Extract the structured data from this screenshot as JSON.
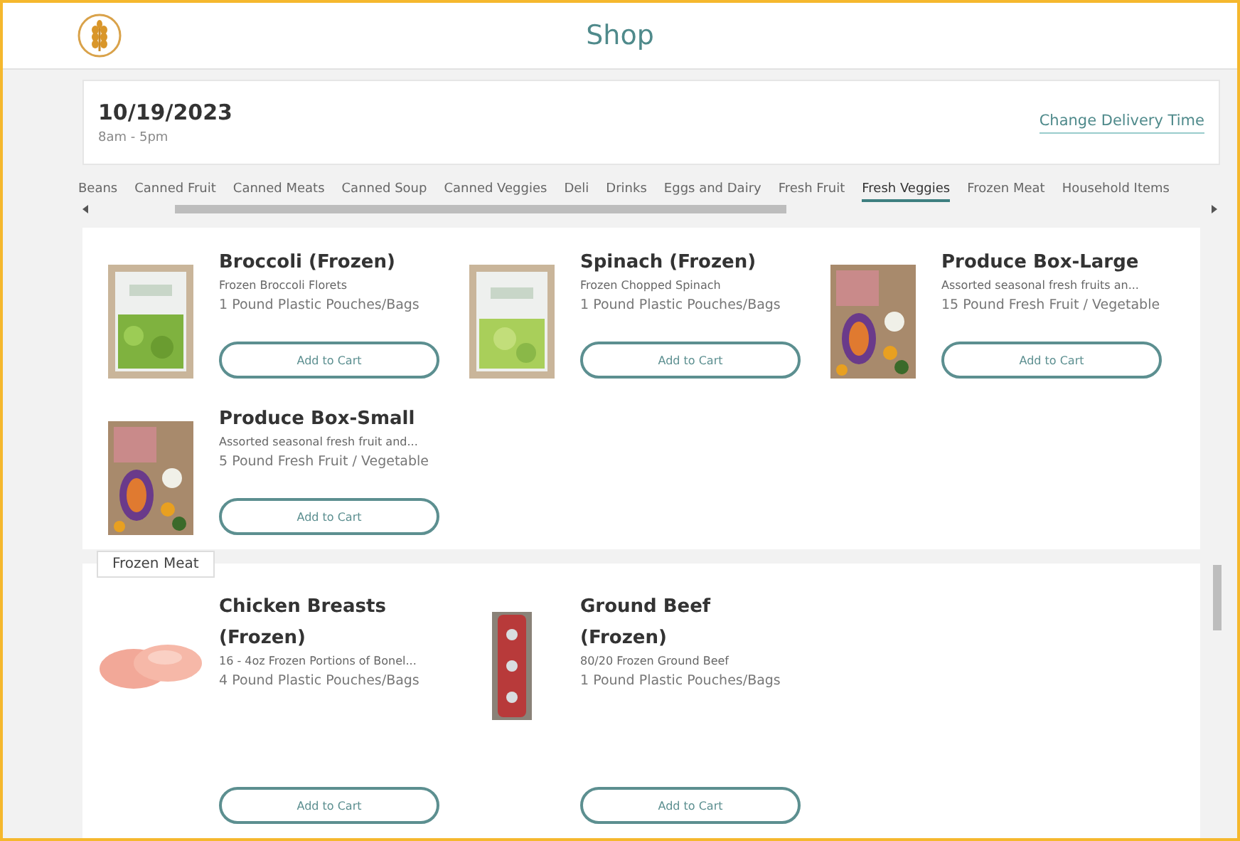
{
  "header": {
    "title": "Shop"
  },
  "delivery": {
    "date": "10/19/2023",
    "hours": "8am - 5pm",
    "action": "Change Delivery Time"
  },
  "tabs": [
    {
      "label": "Beans",
      "selected": false
    },
    {
      "label": "Canned Fruit",
      "selected": false
    },
    {
      "label": "Canned Meats",
      "selected": false
    },
    {
      "label": "Canned Soup",
      "selected": false
    },
    {
      "label": "Canned Veggies",
      "selected": false
    },
    {
      "label": "Deli",
      "selected": false
    },
    {
      "label": "Drinks",
      "selected": false
    },
    {
      "label": "Eggs and Dairy",
      "selected": false
    },
    {
      "label": "Fresh Fruit",
      "selected": false
    },
    {
      "label": "Fresh Veggies",
      "selected": true
    },
    {
      "label": "Frozen Meat",
      "selected": false
    },
    {
      "label": "Household Items",
      "selected": false
    }
  ],
  "sections": [
    {
      "products": [
        {
          "name": "Broccoli (Frozen)",
          "description": "Frozen Broccoli Florets",
          "size": "1 Pound Plastic Pouches/Bags",
          "button": "Add to Cart",
          "kind": "picture"
        },
        {
          "name": "Spinach (Frozen)",
          "description": "Frozen Chopped Spinach",
          "size": "1 Pound Plastic Pouches/Bags",
          "button": "Add to Cart",
          "kind": "picture"
        },
        {
          "name": "Produce Box-Large",
          "description": "Assorted seasonal fresh fruits an...",
          "size": "15 Pound Fresh Fruit / Vegetable",
          "button": "Add to Cart",
          "kind": "picture"
        },
        {
          "name": "Produce Box-Small",
          "description": "Assorted seasonal fresh fruit and...",
          "size": "5 Pound Fresh Fruit / Vegetable",
          "button": "Add to Cart",
          "kind": "picture"
        }
      ]
    },
    {
      "label": "Frozen Meat",
      "products": [
        {
          "name": "Chicken Breasts (Frozen)",
          "description": "16 - 4oz Frozen Portions of Bonel...",
          "size": "4 Pound Plastic Pouches/Bags",
          "button": "Add to Cart",
          "kind": "picture"
        },
        {
          "name": "Ground Beef (Frozen)",
          "description": "80/20 Frozen Ground Beef",
          "size": "1 Pound Plastic Pouches/Bags",
          "button": "Add to Cart",
          "kind": "picture"
        }
      ]
    }
  ]
}
